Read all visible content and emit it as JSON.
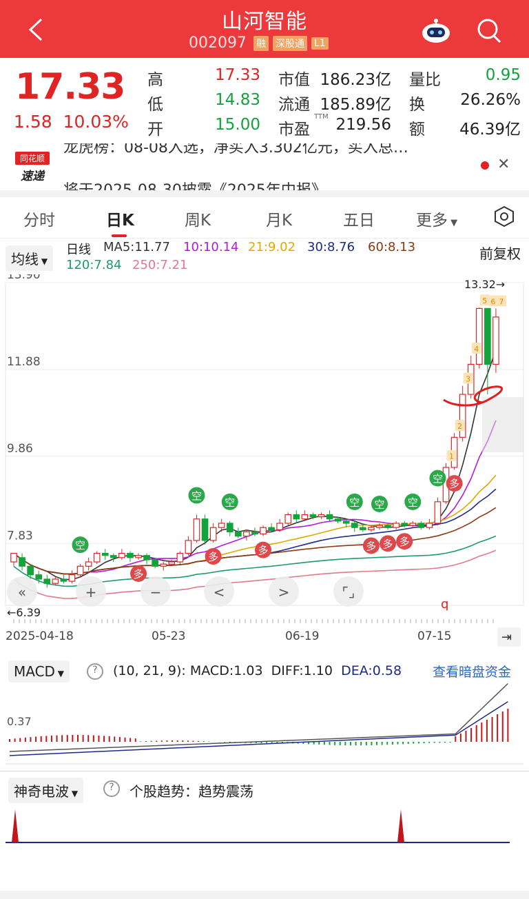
{
  "header": {
    "title": "山河智能",
    "code": "002097",
    "tags": [
      "融",
      "深股通",
      "L1"
    ]
  },
  "quote": {
    "price": "17.33",
    "change": "1.58",
    "change_pct": "10.03%",
    "rows": [
      {
        "l1": "高",
        "v1": "17.33",
        "l2": "市值",
        "v2": "186.23亿",
        "l3": "量比",
        "v3": "0.95"
      },
      {
        "l1": "低",
        "v1": "14.83",
        "l2": "流通",
        "v2": "185.89亿",
        "l3": "换",
        "v3": "26.26%"
      },
      {
        "l1": "开",
        "v1": "15.00",
        "l2": "市盈",
        "v2": "219.56",
        "l3": "额",
        "v3": "46.39亿"
      }
    ],
    "ttm": "TTM"
  },
  "news": {
    "logo_top": "同花顺",
    "logo_bottom": "速递",
    "line1": "龙虎榜：08-08入选，净买入3.302亿元，买入总…",
    "line2": "将于2025-08-30披露《2025年中报》"
  },
  "tabs": [
    "分时",
    "日K",
    "周K",
    "月K",
    "五日",
    "更多"
  ],
  "ma": {
    "selector": "均线",
    "label": "日线",
    "ma5": "MA5:11.77",
    "ma10": "10:10.14",
    "ma21": "21:9.02",
    "ma30": "30:8.76",
    "ma60": "60:8.13",
    "ma120": "120:7.84",
    "ma250": "250:7.21",
    "adjust": "前复权"
  },
  "colors": {
    "ma5": "#333333",
    "ma10": "#b01cd9",
    "ma21": "#e0a800",
    "ma30": "#1b2a8a",
    "ma60": "#8a3a12",
    "ma120": "#1d9a6c",
    "ma250": "#e07a8a"
  },
  "chart_data": {
    "type": "candlestick",
    "ylim": [
      6.39,
      13.9
    ],
    "yticks": [
      "13.90",
      "11.88",
      "9.86",
      "7.83"
    ],
    "xticks": [
      "2025-04-18",
      "05-23",
      "06-19",
      "07-15"
    ],
    "high_marker": "13.32→",
    "low_marker": "←6.39",
    "candles": [
      [
        7.4,
        7.6,
        7.3,
        7.5
      ],
      [
        7.5,
        7.3,
        7.2,
        7.6
      ],
      [
        7.3,
        7.1,
        7.0,
        7.35
      ],
      [
        7.1,
        7.0,
        6.9,
        7.2
      ],
      [
        7.0,
        6.9,
        6.8,
        7.1
      ],
      [
        6.9,
        7.0,
        6.85,
        7.05
      ],
      [
        7.0,
        6.95,
        6.9,
        7.1
      ],
      [
        6.95,
        7.1,
        6.9,
        7.2
      ],
      [
        7.1,
        7.3,
        7.05,
        7.35
      ],
      [
        7.3,
        7.4,
        7.2,
        7.5
      ],
      [
        7.4,
        7.6,
        7.35,
        7.65
      ],
      [
        7.6,
        7.55,
        7.45,
        7.7
      ],
      [
        7.55,
        7.5,
        7.4,
        7.6
      ],
      [
        7.5,
        7.6,
        7.45,
        7.7
      ],
      [
        7.6,
        7.5,
        7.4,
        7.65
      ],
      [
        7.5,
        7.55,
        7.45,
        7.6
      ],
      [
        7.55,
        7.45,
        7.35,
        7.6
      ],
      [
        7.45,
        7.3,
        7.25,
        7.5
      ],
      [
        7.3,
        7.35,
        7.2,
        7.4
      ],
      [
        7.35,
        7.4,
        7.3,
        7.45
      ],
      [
        7.4,
        7.6,
        7.35,
        7.65
      ],
      [
        7.6,
        7.9,
        7.55,
        8.0
      ],
      [
        7.9,
        8.4,
        7.85,
        8.5
      ],
      [
        8.4,
        7.9,
        7.8,
        8.5
      ],
      [
        7.9,
        8.2,
        7.85,
        8.3
      ],
      [
        8.2,
        8.3,
        8.1,
        8.4
      ],
      [
        8.3,
        8.1,
        8.0,
        8.35
      ],
      [
        8.1,
        8.0,
        7.95,
        8.2
      ],
      [
        8.0,
        8.1,
        7.9,
        8.15
      ],
      [
        8.1,
        8.05,
        8.0,
        8.2
      ],
      [
        8.05,
        8.2,
        8.0,
        8.25
      ],
      [
        8.2,
        8.15,
        8.1,
        8.3
      ],
      [
        8.15,
        8.3,
        8.1,
        8.4
      ],
      [
        8.3,
        8.5,
        8.25,
        8.55
      ],
      [
        8.5,
        8.4,
        8.3,
        8.6
      ],
      [
        8.4,
        8.5,
        8.35,
        8.6
      ],
      [
        8.5,
        8.45,
        8.4,
        8.55
      ],
      [
        8.45,
        8.5,
        8.4,
        8.55
      ],
      [
        8.5,
        8.4,
        8.35,
        8.6
      ],
      [
        8.4,
        8.35,
        8.3,
        8.45
      ],
      [
        8.35,
        8.3,
        8.2,
        8.4
      ],
      [
        8.3,
        8.2,
        8.1,
        8.35
      ],
      [
        8.2,
        8.15,
        8.1,
        8.3
      ],
      [
        8.15,
        8.2,
        8.1,
        8.25
      ],
      [
        8.2,
        8.25,
        8.15,
        8.3
      ],
      [
        8.25,
        8.2,
        8.15,
        8.3
      ],
      [
        8.2,
        8.3,
        8.15,
        8.35
      ],
      [
        8.3,
        8.25,
        8.2,
        8.35
      ],
      [
        8.25,
        8.3,
        8.2,
        8.35
      ],
      [
        8.3,
        8.2,
        8.15,
        8.35
      ],
      [
        8.2,
        8.3,
        8.15,
        8.4
      ],
      [
        8.3,
        8.8,
        8.25,
        8.9
      ],
      [
        8.8,
        9.6,
        8.75,
        9.7
      ],
      [
        9.6,
        10.3,
        9.55,
        10.4
      ],
      [
        10.3,
        11.3,
        10.2,
        11.5
      ],
      [
        11.3,
        12.0,
        11.2,
        12.2
      ],
      [
        12.0,
        13.3,
        11.9,
        13.32
      ],
      [
        13.3,
        12.0,
        11.3,
        13.3
      ],
      [
        12.0,
        13.1,
        11.8,
        13.3
      ]
    ],
    "annotations": {
      "buy": "多",
      "sell": "空"
    }
  },
  "controls": {
    "left2": "«",
    "plus": "+",
    "minus": "−",
    "prev": "<",
    "next": ">",
    "fit": "⌜⌟"
  },
  "macd": {
    "selector": "MACD",
    "params": "(10, 21, 9):",
    "macd": "MACD:1.03",
    "diff": "DIFF:1.10",
    "dea": "DEA:0.58",
    "link": "查看暗盘资金",
    "ytick": "0.37"
  },
  "wave": {
    "selector": "神奇电波",
    "trend_label": "个股趋势：",
    "trend": "趋势震荡"
  }
}
